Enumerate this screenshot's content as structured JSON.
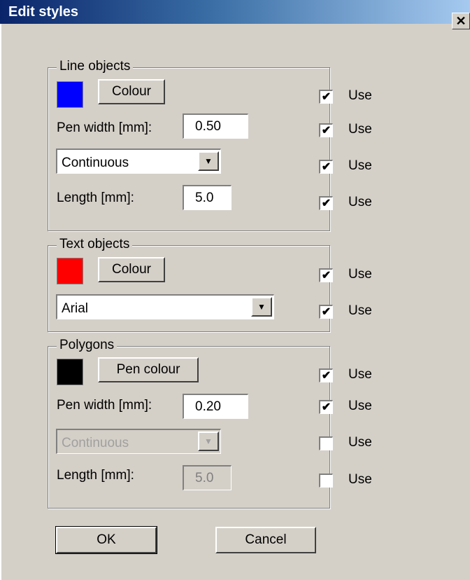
{
  "window": {
    "title": "Edit styles",
    "close_glyph": "✕"
  },
  "line_objects": {
    "title": "Line objects",
    "colour": {
      "label": "Colour",
      "swatch": "#0000ff",
      "use": true,
      "use_label": "Use"
    },
    "pen_width": {
      "label": "Pen width [mm]:",
      "value": "0.50",
      "use": true,
      "use_label": "Use"
    },
    "line_type": {
      "value": "Continuous",
      "use": true,
      "use_label": "Use"
    },
    "length": {
      "label": "Length [mm]:",
      "value": "5.0",
      "use": true,
      "use_label": "Use"
    }
  },
  "text_objects": {
    "title": "Text objects",
    "colour": {
      "label": "Colour",
      "swatch": "#ff0000",
      "use": true,
      "use_label": "Use"
    },
    "font": {
      "value": "Arial",
      "use": true,
      "use_label": "Use"
    }
  },
  "polygons": {
    "title": "Polygons",
    "pen_colour": {
      "label": "Pen colour",
      "swatch": "#000000",
      "use": true,
      "use_label": "Use"
    },
    "pen_width": {
      "label": "Pen width [mm]:",
      "value": "0.20",
      "use": true,
      "use_label": "Use"
    },
    "line_type": {
      "value": "Continuous",
      "use": false,
      "use_label": "Use",
      "disabled": true
    },
    "length": {
      "label": "Length [mm]:",
      "value": "5.0",
      "use": false,
      "use_label": "Use",
      "disabled": true
    }
  },
  "buttons": {
    "ok": "OK",
    "cancel": "Cancel"
  },
  "icons": {
    "dropdown": "chevron-down-icon",
    "check": "check-icon"
  }
}
